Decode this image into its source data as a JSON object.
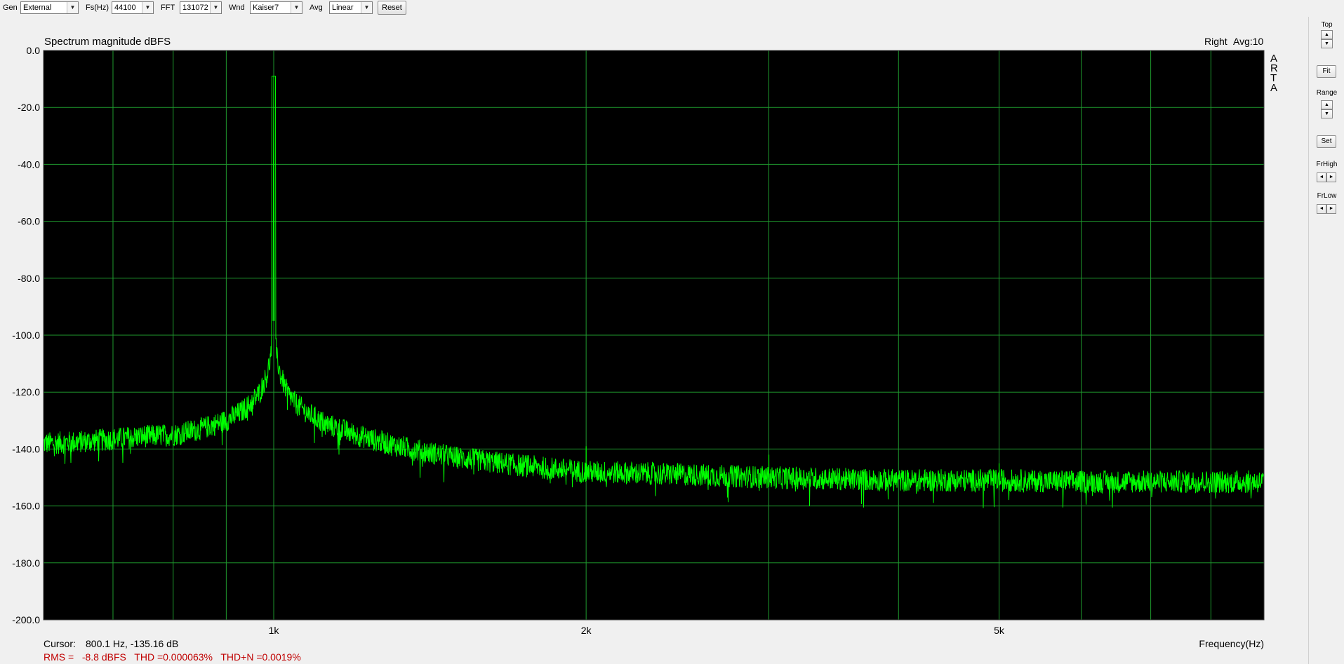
{
  "toolbar": {
    "gen_label": "Gen",
    "gen_value": "External",
    "fs_label": "Fs(Hz)",
    "fs_value": "44100",
    "fft_label": "FFT",
    "fft_value": "131072",
    "wnd_label": "Wnd",
    "wnd_value": "Kaiser7",
    "avg_label": "Avg",
    "avg_value": "Linear",
    "reset_label": "Reset",
    "dropdown_icon": "chevron-down-icon"
  },
  "plot": {
    "title": "Spectrum magnitude dBFS",
    "channel": "Right",
    "avg_info": "Avg:10",
    "logo_letters": [
      "A",
      "R",
      "T",
      "A"
    ],
    "xlabel": "Frequency(Hz)",
    "cursor_label": "Cursor:",
    "cursor_value": "800.1 Hz, -135.16 dB",
    "stats": "RMS =   -8.8 dBFS   THD =0.000063%   THD+N =0.0019%",
    "colors": {
      "background": "#000000",
      "grid": "#1f9a2e",
      "trace": "#00ff00",
      "stats_text": "#c00000"
    }
  },
  "side": {
    "top_label": "Top",
    "fit_label": "Fit",
    "range_label": "Range",
    "set_label": "Set",
    "frhigh_label": "FrHigh",
    "frlow_label": "FrLow",
    "up_icon": "▲",
    "down_icon": "▼",
    "left_icon": "◄",
    "right_icon": "►"
  },
  "chart_data": {
    "type": "line",
    "title": "Spectrum magnitude dBFS",
    "xlabel": "Frequency(Hz)",
    "ylabel": "",
    "xscale": "log",
    "xlim": [
      600,
      9000
    ],
    "ylim": [
      -200,
      0
    ],
    "grid": true,
    "x_ticks": [
      {
        "value": 1000,
        "label": "1k"
      },
      {
        "value": 2000,
        "label": "2k"
      },
      {
        "value": 5000,
        "label": "5k"
      }
    ],
    "y_ticks": [
      {
        "value": 0,
        "label": "0.0"
      },
      {
        "value": -20,
        "label": "-20.0"
      },
      {
        "value": -40,
        "label": "-40.0"
      },
      {
        "value": -60,
        "label": "-60.0"
      },
      {
        "value": -80,
        "label": "-80.0"
      },
      {
        "value": -100,
        "label": "-100.0"
      },
      {
        "value": -120,
        "label": "-120.0"
      },
      {
        "value": -140,
        "label": "-140.0"
      },
      {
        "value": -160,
        "label": "-160.0"
      },
      {
        "value": -180,
        "label": "-180.0"
      },
      {
        "value": -200,
        "label": "-200.0"
      }
    ],
    "series": [
      {
        "x": [
          600,
          650,
          700,
          750,
          800,
          850,
          900,
          930,
          950,
          970,
          985,
          993,
          997,
          999,
          1000,
          1001,
          1003,
          1007,
          1015,
          1030,
          1050,
          1080,
          1120,
          1200,
          1300,
          1400,
          1500,
          1700,
          2000,
          2500,
          3000,
          4000,
          5000,
          6000,
          7000,
          8000,
          9000
        ],
        "y": [
          -138,
          -137.5,
          -136.5,
          -135.5,
          -135,
          -133,
          -130,
          -127,
          -124,
          -120,
          -114,
          -108,
          -100,
          -90,
          -9,
          -90,
          -100,
          -108,
          -114,
          -120,
          -124,
          -127.5,
          -131,
          -135,
          -138.5,
          -141,
          -143,
          -145.5,
          -148,
          -149,
          -150,
          -151,
          -151,
          -151.5,
          -151.5,
          -151.5,
          -151.5
        ]
      }
    ],
    "noise_band_db": 4,
    "spurs": [
      {
        "x": 2000,
        "y": -139
      },
      {
        "x": 3000,
        "y": -142
      },
      {
        "x": 5000,
        "y": -145
      }
    ]
  }
}
